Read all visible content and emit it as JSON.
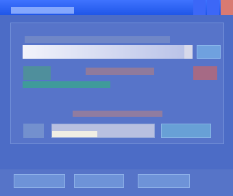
{
  "window": {
    "controls": [
      "minimize",
      "maximize",
      "close"
    ]
  },
  "dialog": {
    "progress_percent": 95
  },
  "colors": {
    "title_bar": "#2d63f3",
    "window_background": "#4c6cc6",
    "dialog_background": "#5774c9",
    "progress_track": "#d7d9ea",
    "accent_green": "#4f8f9c",
    "accent_teal": "#3f9b9a",
    "accent_pink": "#a66a85",
    "button_blue": "#68a0d6"
  },
  "icons": {
    "close": "close-icon",
    "minimize": "minimize-icon",
    "maximize": "maximize-icon"
  }
}
